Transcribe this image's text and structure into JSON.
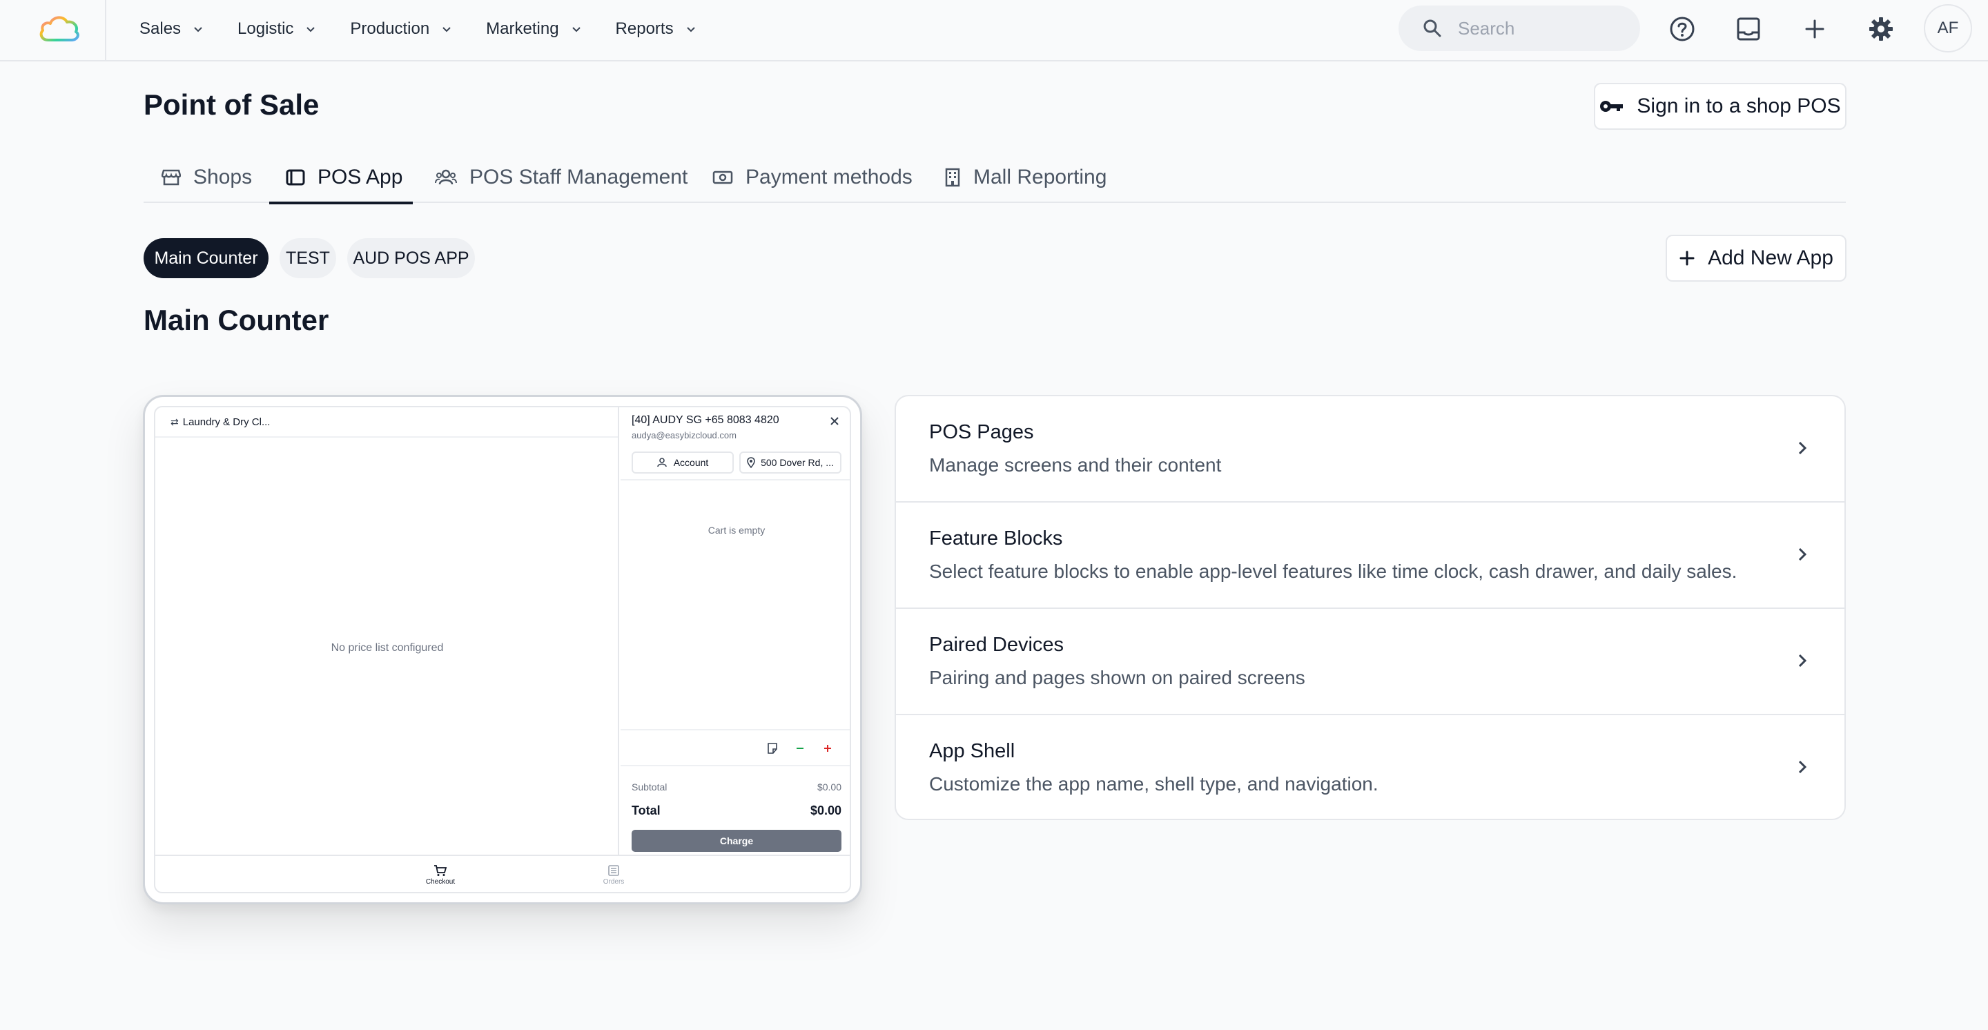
{
  "nav": {
    "menu": [
      {
        "label": "Sales"
      },
      {
        "label": "Logistic"
      },
      {
        "label": "Production"
      },
      {
        "label": "Marketing"
      },
      {
        "label": "Reports"
      }
    ],
    "search_placeholder": "Search",
    "tools": [
      "help-icon",
      "inbox-icon",
      "plus-icon",
      "gear-icon"
    ],
    "avatar_initials": "AF"
  },
  "header": {
    "title": "Point of Sale",
    "sign_in_label": "Sign in to a shop POS"
  },
  "tabs": [
    {
      "label": "Shops",
      "icon": "store-icon",
      "active": false
    },
    {
      "label": "POS App",
      "icon": "tablet-icon",
      "active": true
    },
    {
      "label": "POS Staff Management",
      "icon": "users-icon",
      "active": false
    },
    {
      "label": "Payment methods",
      "icon": "cash-icon",
      "active": false
    },
    {
      "label": "Mall Reporting",
      "icon": "building-icon",
      "active": false
    }
  ],
  "apps": {
    "pills": [
      {
        "label": "Main Counter",
        "active": true
      },
      {
        "label": "TEST",
        "active": false
      },
      {
        "label": "AUD POS APP",
        "active": false
      }
    ],
    "add_label": "Add New App"
  },
  "section_title": "Main Counter",
  "preview": {
    "shop_label": "Laundry & Dry Cl...",
    "empty_left": "No price list configured",
    "customer_name": "[40] AUDY SG +65 8083 4820",
    "customer_email": "audya@easybizcloud.com",
    "account_label": "Account",
    "address_label": "500 Dover Rd, ...",
    "cart_empty": "Cart is empty",
    "subtotal_label": "Subtotal",
    "subtotal_value": "$0.00",
    "total_label": "Total",
    "total_value": "$0.00",
    "charge_label": "Charge",
    "bottom_nav": [
      {
        "label": "Checkout",
        "active": true
      },
      {
        "label": "Orders",
        "active": false
      }
    ]
  },
  "settings": [
    {
      "title": "POS Pages",
      "desc": "Manage screens and their content"
    },
    {
      "title": "Feature Blocks",
      "desc": "Select feature blocks to enable app-level features like time clock, cash drawer, and daily sales."
    },
    {
      "title": "Paired Devices",
      "desc": "Pairing and pages shown on paired screens"
    },
    {
      "title": "App Shell",
      "desc": "Customize the app name, shell type, and navigation."
    }
  ],
  "colors": {
    "primary": "#111827",
    "background": "#f9fafb",
    "border": "#e5e7eb",
    "muted_text": "#4b5563",
    "minus": "#16a34a",
    "plus": "#dc2626"
  }
}
